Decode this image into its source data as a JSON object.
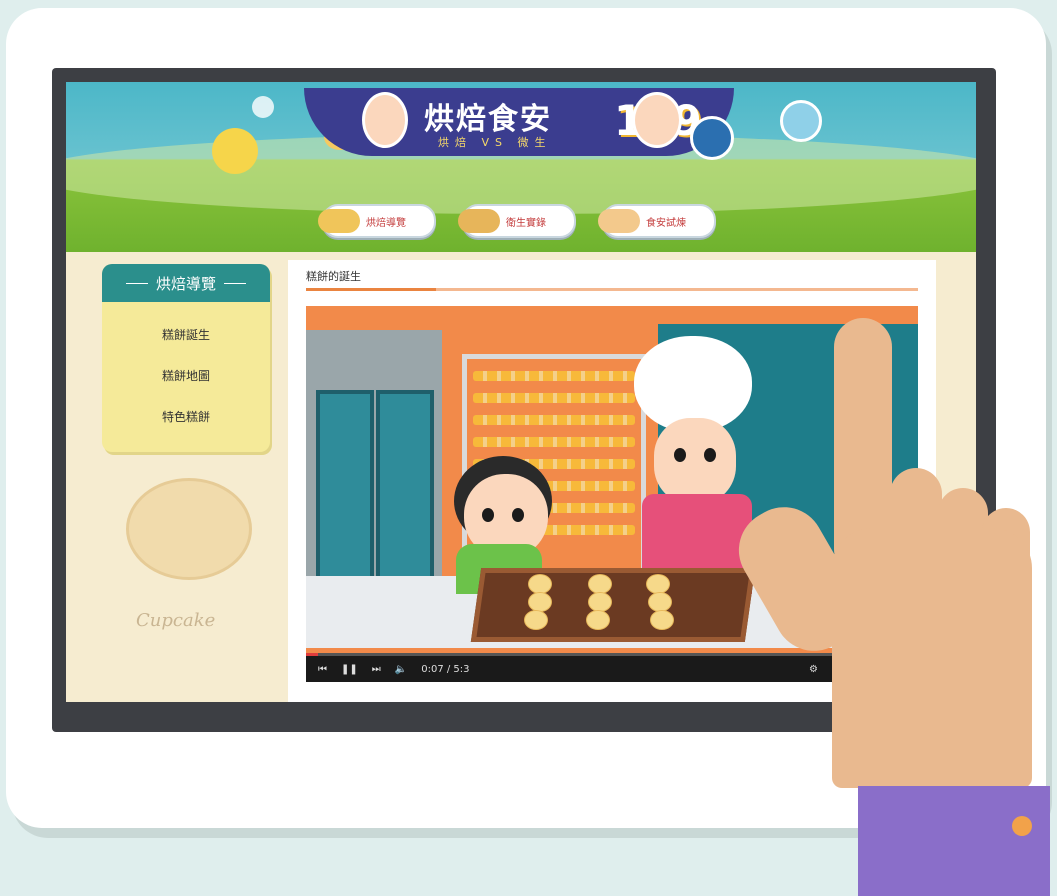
{
  "header": {
    "title": "烘焙食安",
    "title_num": "139",
    "subtitle": "烘焙 VS 微生"
  },
  "nav": {
    "items": [
      {
        "label": "烘焙導覽"
      },
      {
        "label": "衛生實錄"
      },
      {
        "label": "食安試煉"
      }
    ]
  },
  "sidebar": {
    "heading": "烘焙導覽",
    "items": [
      {
        "label": "糕餅誕生"
      },
      {
        "label": "糕餅地圖"
      },
      {
        "label": "特色糕餅"
      }
    ]
  },
  "content": {
    "title": "糕餅的誕生"
  },
  "video": {
    "time": "0:07 / 5:3",
    "progress": 0.02
  },
  "decor": {
    "script_text": "Cupcake"
  },
  "colors": {
    "sidebar_head": "#2b8f8c",
    "title_pill": "#3b3d8f",
    "accent_orange": "#ea8440",
    "cuff": "#8a6ec9"
  }
}
